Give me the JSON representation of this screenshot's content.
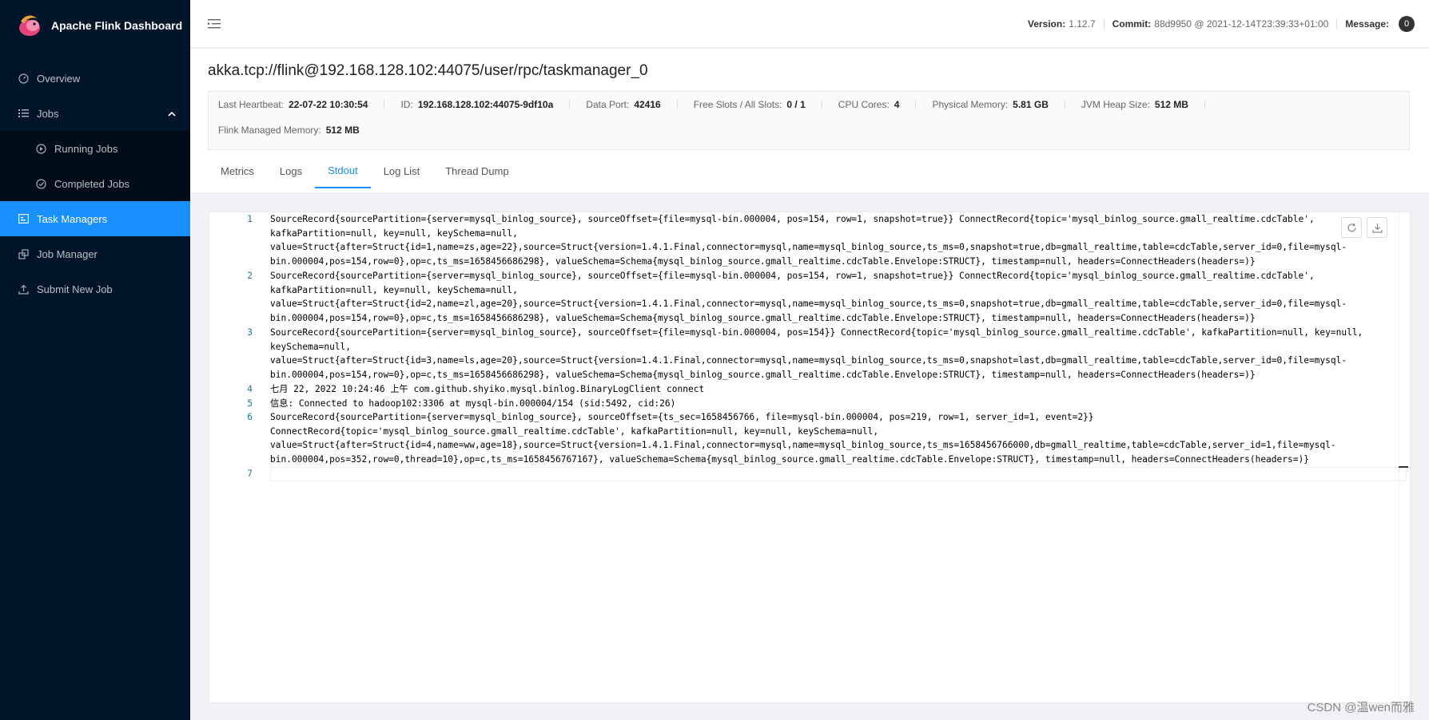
{
  "sidebar": {
    "brand": "Apache Flink Dashboard",
    "items": [
      {
        "label": "Overview",
        "icon": "dashboard-icon"
      },
      {
        "label": "Jobs",
        "icon": "list-icon"
      },
      {
        "label": "Running Jobs",
        "icon": "play-circle-icon"
      },
      {
        "label": "Completed Jobs",
        "icon": "check-circle-icon"
      },
      {
        "label": "Task Managers",
        "icon": "schedule-icon"
      },
      {
        "label": "Job Manager",
        "icon": "build-icon"
      },
      {
        "label": "Submit New Job",
        "icon": "upload-icon"
      }
    ]
  },
  "header": {
    "version_label": "Version:",
    "version_value": "1.12.7",
    "commit_label": "Commit:",
    "commit_value": "88d9950 @ 2021-12-14T23:39:33+01:00",
    "message_label": "Message:",
    "message_count": "0"
  },
  "taskmanager": {
    "address": "akka.tcp://flink@192.168.128.102:44075/user/rpc/taskmanager_0",
    "desc": [
      {
        "k": "Last Heartbeat:",
        "v": "22-07-22 10:30:54"
      },
      {
        "k": "ID:",
        "v": "192.168.128.102:44075-9df10a"
      },
      {
        "k": "Data Port:",
        "v": "42416"
      },
      {
        "k": "Free Slots / All Slots:",
        "v": "0 / 1"
      },
      {
        "k": "CPU Cores:",
        "v": "4"
      },
      {
        "k": "Physical Memory:",
        "v": "5.81 GB"
      },
      {
        "k": "JVM Heap Size:",
        "v": "512 MB"
      },
      {
        "k": "Flink Managed Memory:",
        "v": "512 MB"
      }
    ]
  },
  "tabs": [
    "Metrics",
    "Logs",
    "Stdout",
    "Log List",
    "Thread Dump"
  ],
  "active_tab": "Stdout",
  "stdout_lines": [
    {
      "num": "1",
      "text": "SourceRecord{sourcePartition={server=mysql_binlog_source}, sourceOffset={file=mysql-bin.000004, pos=154, row=1, snapshot=true}} ConnectRecord{topic='mysql_binlog_source.gmall_realtime.cdcTable', kafkaPartition=null, key=null, keySchema=null, value=Struct{after=Struct{id=1,name=zs,age=22},source=Struct{version=1.4.1.Final,connector=mysql,name=mysql_binlog_source,ts_ms=0,snapshot=true,db=gmall_realtime,table=cdcTable,server_id=0,file=mysql-bin.000004,pos=154,row=0},op=c,ts_ms=1658456686298}, valueSchema=Schema{mysql_binlog_source.gmall_realtime.cdcTable.Envelope:STRUCT}, timestamp=null, headers=ConnectHeaders(headers=)}"
    },
    {
      "num": "2",
      "text": "SourceRecord{sourcePartition={server=mysql_binlog_source}, sourceOffset={file=mysql-bin.000004, pos=154, row=1, snapshot=true}} ConnectRecord{topic='mysql_binlog_source.gmall_realtime.cdcTable', kafkaPartition=null, key=null, keySchema=null, value=Struct{after=Struct{id=2,name=zl,age=20},source=Struct{version=1.4.1.Final,connector=mysql,name=mysql_binlog_source,ts_ms=0,snapshot=true,db=gmall_realtime,table=cdcTable,server_id=0,file=mysql-bin.000004,pos=154,row=0},op=c,ts_ms=1658456686298}, valueSchema=Schema{mysql_binlog_source.gmall_realtime.cdcTable.Envelope:STRUCT}, timestamp=null, headers=ConnectHeaders(headers=)}"
    },
    {
      "num": "3",
      "text": "SourceRecord{sourcePartition={server=mysql_binlog_source}, sourceOffset={file=mysql-bin.000004, pos=154}} ConnectRecord{topic='mysql_binlog_source.gmall_realtime.cdcTable', kafkaPartition=null, key=null, keySchema=null, value=Struct{after=Struct{id=3,name=ls,age=20},source=Struct{version=1.4.1.Final,connector=mysql,name=mysql_binlog_source,ts_ms=0,snapshot=last,db=gmall_realtime,table=cdcTable,server_id=0,file=mysql-bin.000004,pos=154,row=0},op=c,ts_ms=1658456686298}, valueSchema=Schema{mysql_binlog_source.gmall_realtime.cdcTable.Envelope:STRUCT}, timestamp=null, headers=ConnectHeaders(headers=)}"
    },
    {
      "num": "4",
      "text": "七月 22, 2022 10:24:46 上午 com.github.shyiko.mysql.binlog.BinaryLogClient connect"
    },
    {
      "num": "5",
      "text": "信息: Connected to hadoop102:3306 at mysql-bin.000004/154 (sid:5492, cid:26)"
    },
    {
      "num": "6",
      "text": "SourceRecord{sourcePartition={server=mysql_binlog_source}, sourceOffset={ts_sec=1658456766, file=mysql-bin.000004, pos=219, row=1, server_id=1, event=2}} ConnectRecord{topic='mysql_binlog_source.gmall_realtime.cdcTable', kafkaPartition=null, key=null, keySchema=null, value=Struct{after=Struct{id=4,name=ww,age=18},source=Struct{version=1.4.1.Final,connector=mysql,name=mysql_binlog_source,ts_ms=1658456766000,db=gmall_realtime,table=cdcTable,server_id=1,file=mysql-bin.000004,pos=352,row=0,thread=10},op=c,ts_ms=1658456767167}, valueSchema=Schema{mysql_binlog_source.gmall_realtime.cdcTable.Envelope:STRUCT}, timestamp=null, headers=ConnectHeaders(headers=)}"
    },
    {
      "num": "7",
      "text": ""
    }
  ],
  "watermark": "CSDN @温wen而雅",
  "colors": {
    "sidebar_bg": "#001529",
    "accent": "#1890ff"
  }
}
